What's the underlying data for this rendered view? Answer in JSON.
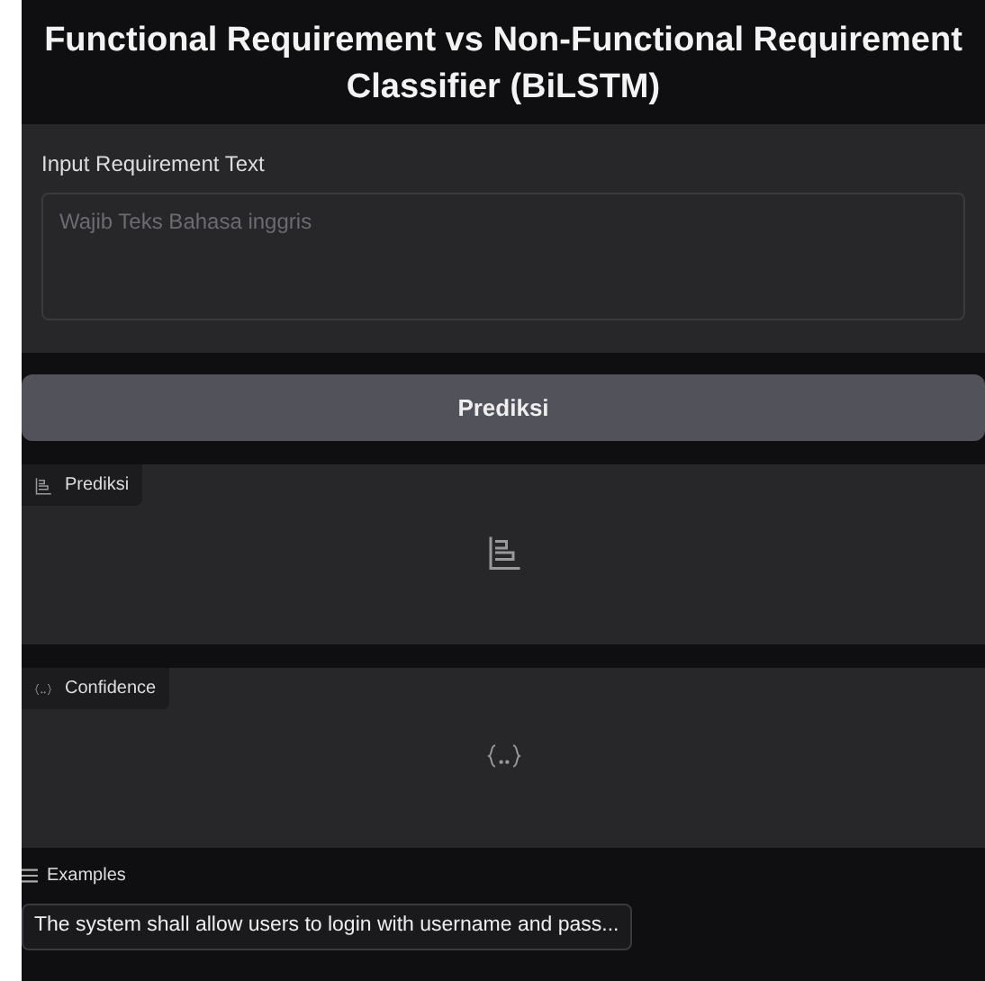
{
  "title": "Functional Requirement vs Non-Functional Requirement Classifier (BiLSTM)",
  "input": {
    "label": "Input Requirement Text",
    "placeholder": "Wajib Teks Bahasa inggris"
  },
  "button": "Prediksi",
  "outputs": [
    {
      "kind": "label",
      "label": "Prediksi"
    },
    {
      "kind": "json",
      "label": "Confidence"
    }
  ],
  "examples": {
    "label": "Examples",
    "items": [
      "The system shall allow users to login with username and pass..."
    ]
  }
}
